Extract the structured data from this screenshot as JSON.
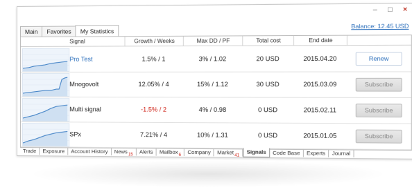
{
  "window": {
    "controls": [
      {
        "icon": "minimize-icon",
        "glyph": "–"
      },
      {
        "icon": "maximize-icon",
        "glyph": "□"
      },
      {
        "icon": "close-icon",
        "glyph": "×"
      }
    ]
  },
  "top_tabs": [
    {
      "label": "Main",
      "active": false
    },
    {
      "label": "Favorites",
      "active": false
    },
    {
      "label": "My Statistics",
      "active": true
    }
  ],
  "balance_label": "Balance: 12.45 USD",
  "table": {
    "headers": [
      "Signal",
      "Growth / Weeks",
      "Max DD / PF",
      "Total cost",
      "End date"
    ],
    "rows": [
      {
        "signal": "Pro Test",
        "growth": "1.5% / 1",
        "dd": "3% / 1.02",
        "cost": "20 USD",
        "end": "2015.04.20",
        "action": "Renew",
        "link": true,
        "negative": false
      },
      {
        "signal": "Mnogovolt",
        "growth": "12.05% / 4",
        "dd": "15% / 1.12",
        "cost": "30 USD",
        "end": "2015.03.09",
        "action": "Subscribe",
        "link": false,
        "negative": false
      },
      {
        "signal": "Multi signal",
        "growth": "-1.5% / 2",
        "dd": "4% / 0.98",
        "cost": "0 USD",
        "end": "2015.02.11",
        "action": "Subscribe",
        "link": false,
        "negative": true
      },
      {
        "signal": "SPx",
        "growth": "7.21% / 4",
        "dd": "10% / 1.31",
        "cost": "0 USD",
        "end": "2015.01.05",
        "action": "Subscribe",
        "link": false,
        "negative": false
      }
    ]
  },
  "bottom_tabs": [
    {
      "label": "Trade",
      "badge": ""
    },
    {
      "label": "Exposure",
      "badge": ""
    },
    {
      "label": "Account History",
      "badge": ""
    },
    {
      "label": "News",
      "badge": "15"
    },
    {
      "label": "Alerts",
      "badge": ""
    },
    {
      "label": "Mailbox",
      "badge": "6"
    },
    {
      "label": "Company",
      "badge": ""
    },
    {
      "label": "Market",
      "badge": "41"
    },
    {
      "label": "Signals",
      "badge": "",
      "active": true
    },
    {
      "label": "Code Base",
      "badge": ""
    },
    {
      "label": "Experts",
      "badge": ""
    },
    {
      "label": "Journal",
      "badge": ""
    }
  ],
  "colors": {
    "link": "#2a6ebb",
    "negative": "#d0261b",
    "chart_line": "#3a7dc4",
    "chart_fill": "#cfe0f2"
  }
}
